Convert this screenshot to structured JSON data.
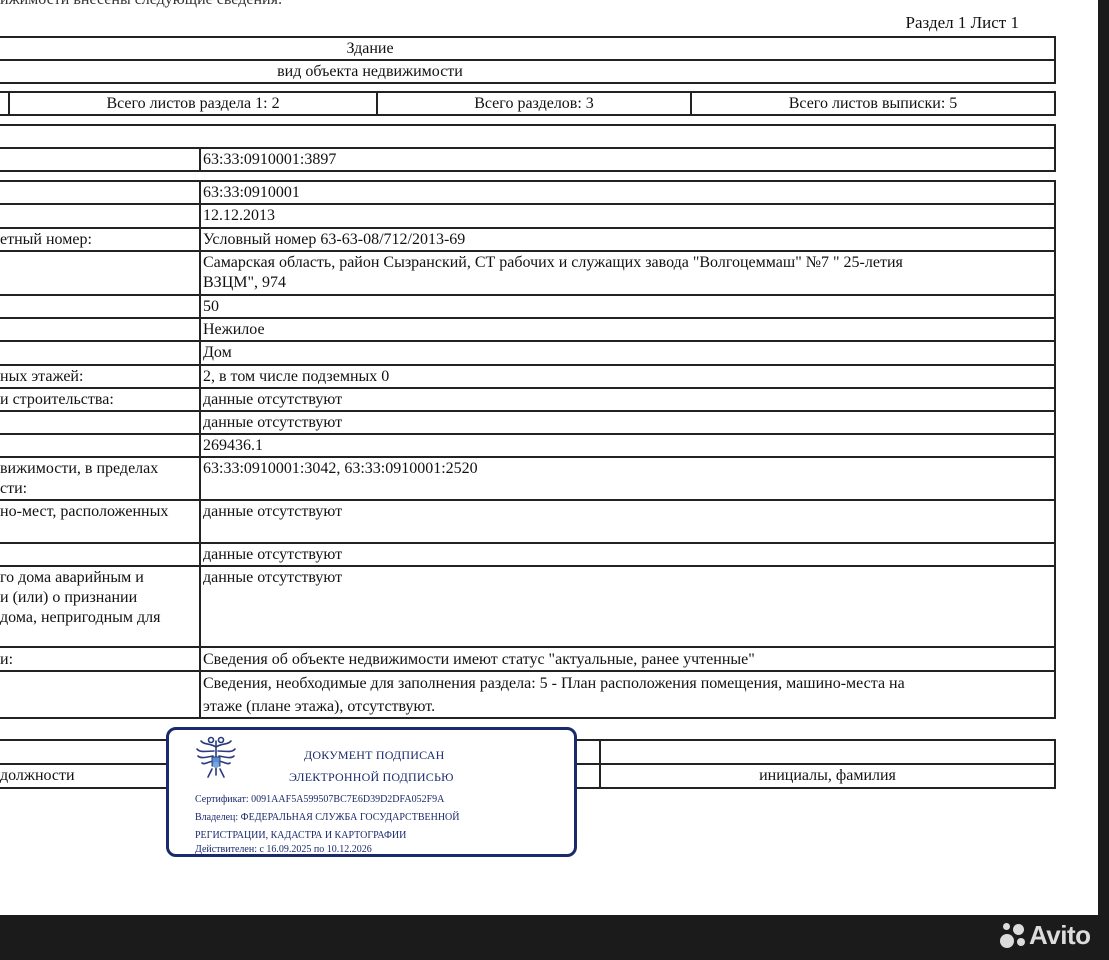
{
  "header": {
    "top_cut_text": "ижимости внесены следующие сведения:",
    "section_label": "Раздел 1 Лист 1"
  },
  "title_block": {
    "object_type": "Здание",
    "object_type_caption": "вид объекта недвижимости",
    "sheets_section": "Всего листов раздела 1: 2",
    "sections_total": "Всего разделов: 3",
    "sheets_total": "Всего листов выписки: 5"
  },
  "rows": [
    {
      "label": "",
      "value": "63:33:0910001:3897"
    },
    {
      "label": "",
      "value": "63:33:0910001"
    },
    {
      "label": "",
      "value": "12.12.2013"
    },
    {
      "label": "етный номер:",
      "value": "Условный номер 63-63-08/712/2013-69"
    },
    {
      "label": "",
      "value": "Самарская область, район Сызранский, СТ рабочих и служащих завода \"Волгоцеммаш\" №7 \" 25-летия",
      "value2": "ВЗЦМ\", 974"
    },
    {
      "label": "",
      "value": "50"
    },
    {
      "label": "",
      "value": "Нежилое"
    },
    {
      "label": "",
      "value": "Дом"
    },
    {
      "label": "ных этажей:",
      "value": "2, в том числе подземных 0"
    },
    {
      "label": "и строительства:",
      "value": "данные отсутствуют"
    },
    {
      "label": "",
      "value": "данные отсутствуют"
    },
    {
      "label": "",
      "value": "269436.1"
    },
    {
      "label": "вижимости, в пределах",
      "label2": "сти:",
      "value": "63:33:0910001:3042, 63:33:0910001:2520"
    },
    {
      "label": "но-мест, расположенных",
      "value": "данные отсутствуют"
    },
    {
      "label": "",
      "value": "данные отсутствуют"
    },
    {
      "label": "го дома аварийным и",
      "label2": "и (или) о признании",
      "label3": "дома, непригодным для",
      "value": "данные отсутствуют"
    },
    {
      "label": "и:",
      "value": "Сведения об объекте недвижимости имеют статус \"актуальные, ранее учтенные\""
    },
    {
      "label": "",
      "value": "Сведения, необходимые для заполнения раздела: 5 - План расположения помещения, машино-места на",
      "value2": "этаже (плане этажа), отсутствуют."
    }
  ],
  "footer": {
    "position_caption": "должности",
    "name_caption": "инициалы, фамилия"
  },
  "stamp": {
    "line1": "ДОКУМЕНТ ПОДПИСАН",
    "line2": "ЭЛЕКТРОННОЙ ПОДПИСЬЮ",
    "certificate": "Сертификат: 0091AAF5A599507BC7E6D39D2DFA052F9A",
    "owner1": "Владелец: ФЕДЕРАЛЬНАЯ СЛУЖБА ГОСУДАРСТВЕННОЙ",
    "owner2": "РЕГИСТРАЦИИ, КАДАСТРА И КАРТОГРАФИИ",
    "valid": "Действителен: с 16.09.2025 по 10.12.2026",
    "color": "#1a2a6c",
    "emblem_icon": "double-headed-eagle-icon"
  },
  "watermark": {
    "text": "Avito"
  }
}
